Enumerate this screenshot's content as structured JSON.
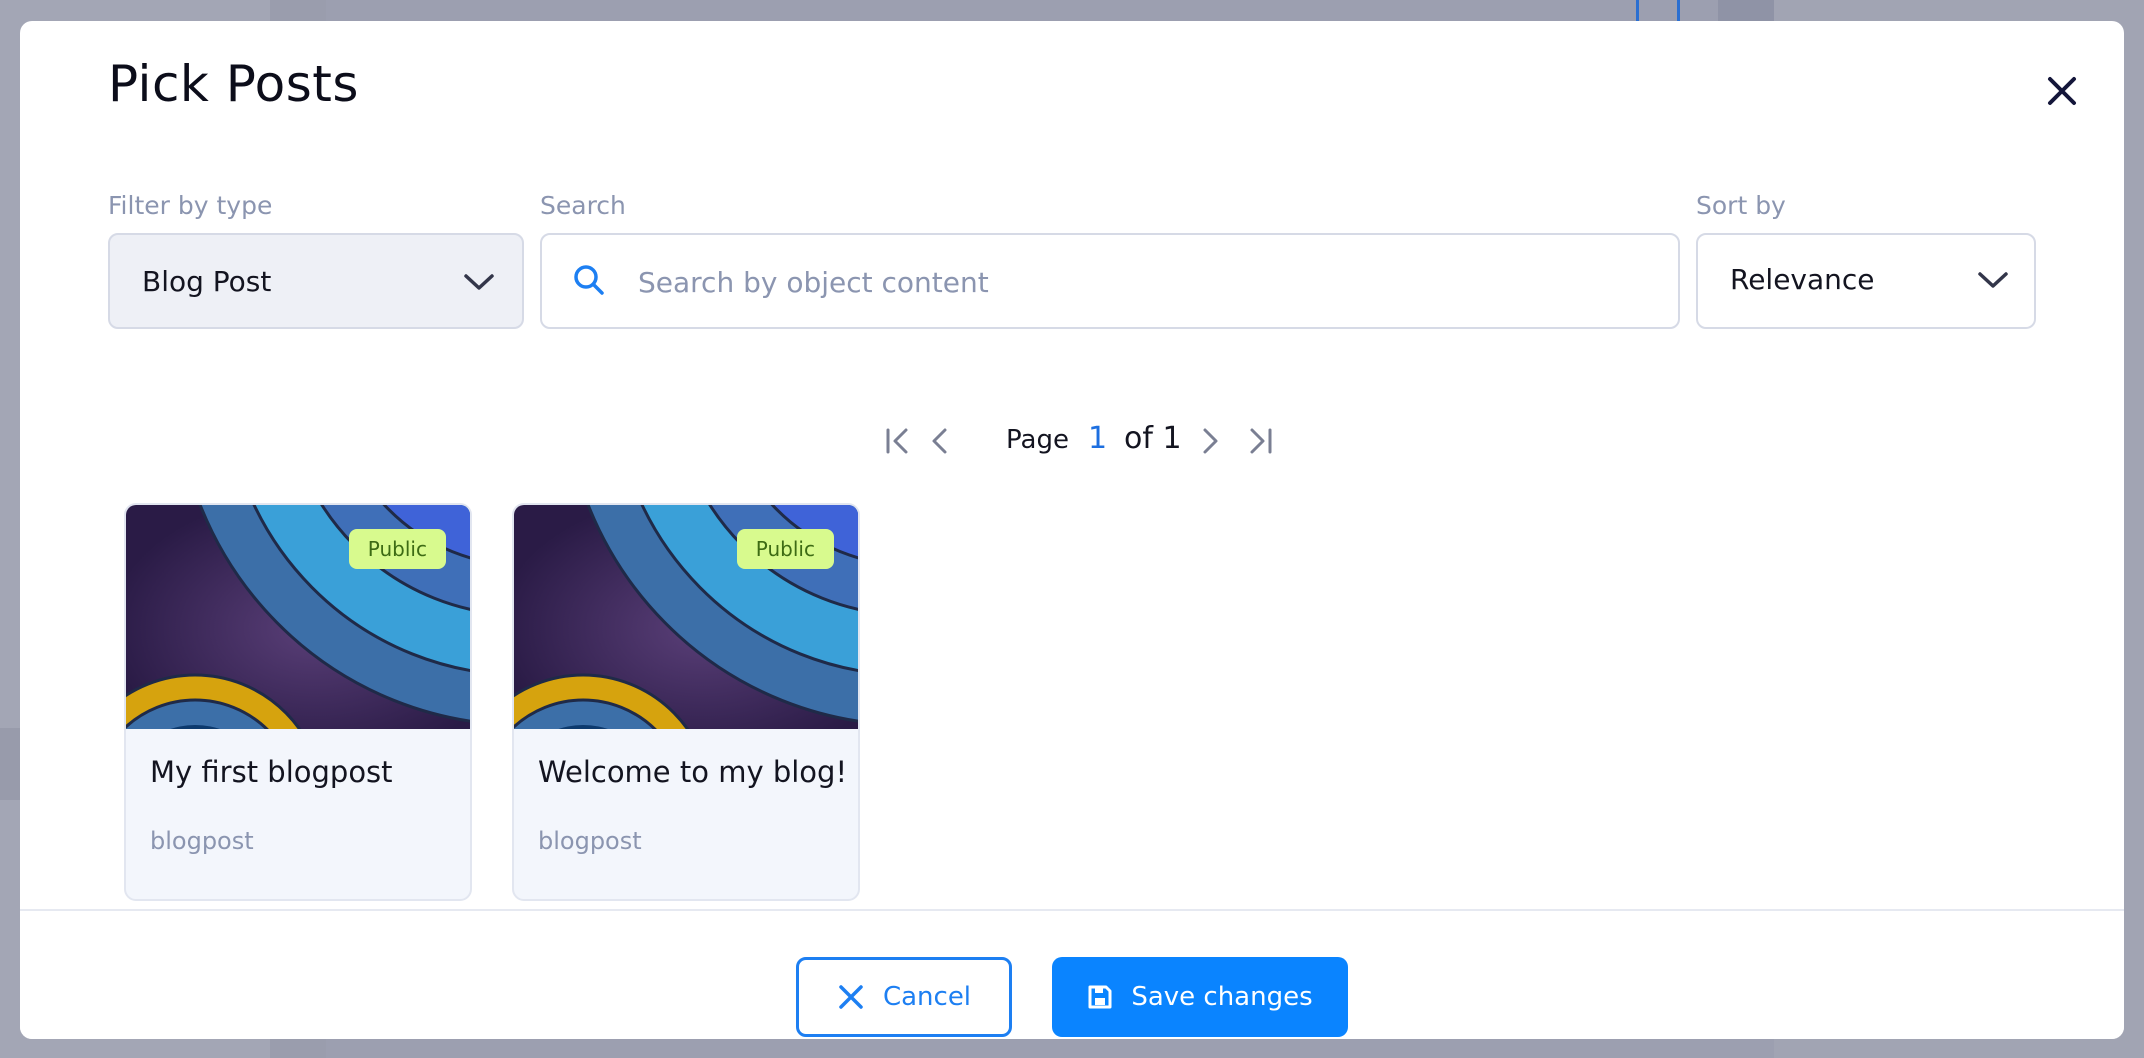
{
  "modal": {
    "title": "Pick Posts"
  },
  "filters": {
    "type_label": "Filter by type",
    "type_value": "Blog Post",
    "search_label": "Search",
    "search_placeholder": "Search by object content",
    "search_value": "",
    "sort_label": "Sort by",
    "sort_value": "Relevance"
  },
  "pagination": {
    "page_label": "Page",
    "current_page": "1",
    "of_label": "of 1"
  },
  "posts": [
    {
      "title": "My first blogpost",
      "type": "blogpost",
      "badge": "Public"
    },
    {
      "title": "Welcome to my blog!",
      "type": "blogpost",
      "badge": "Public"
    }
  ],
  "footer": {
    "cancel_label": "Cancel",
    "save_label": "Save changes"
  },
  "colors": {
    "accent": "#0a84ff",
    "badge_bg": "#d8fa8e",
    "badge_text": "#3d6b14"
  },
  "icons": {
    "close": "close-icon",
    "search": "search-icon",
    "dropdown": "chevron-down-icon",
    "first_page": "first-page-icon",
    "prev_page": "chevron-left-icon",
    "next_page": "chevron-right-icon",
    "last_page": "last-page-icon",
    "cancel": "x-icon",
    "save": "save-icon"
  }
}
